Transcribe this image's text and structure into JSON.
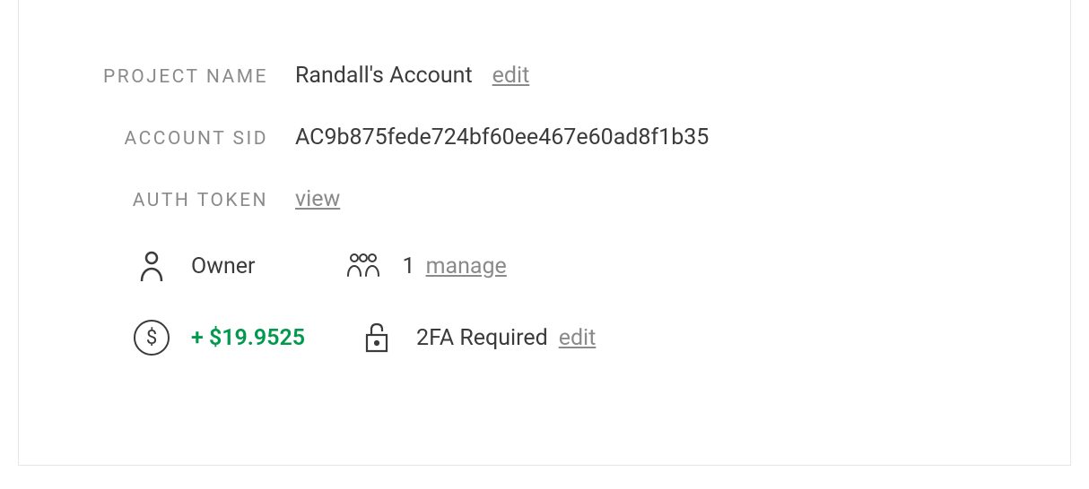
{
  "labels": {
    "project_name": "PROJECT NAME",
    "account_sid": "ACCOUNT SID",
    "auth_token": "AUTH TOKEN"
  },
  "project": {
    "name": "Randall's Account",
    "edit_label": "edit",
    "account_sid": "AC9b875fede724bf60ee467e60ad8f1b35",
    "auth_token_view_label": "view"
  },
  "meta": {
    "role": "Owner",
    "users_count": "1",
    "users_manage_label": "manage",
    "balance": "+ $19.9525",
    "security_status": "2FA Required",
    "security_edit_label": "edit"
  }
}
